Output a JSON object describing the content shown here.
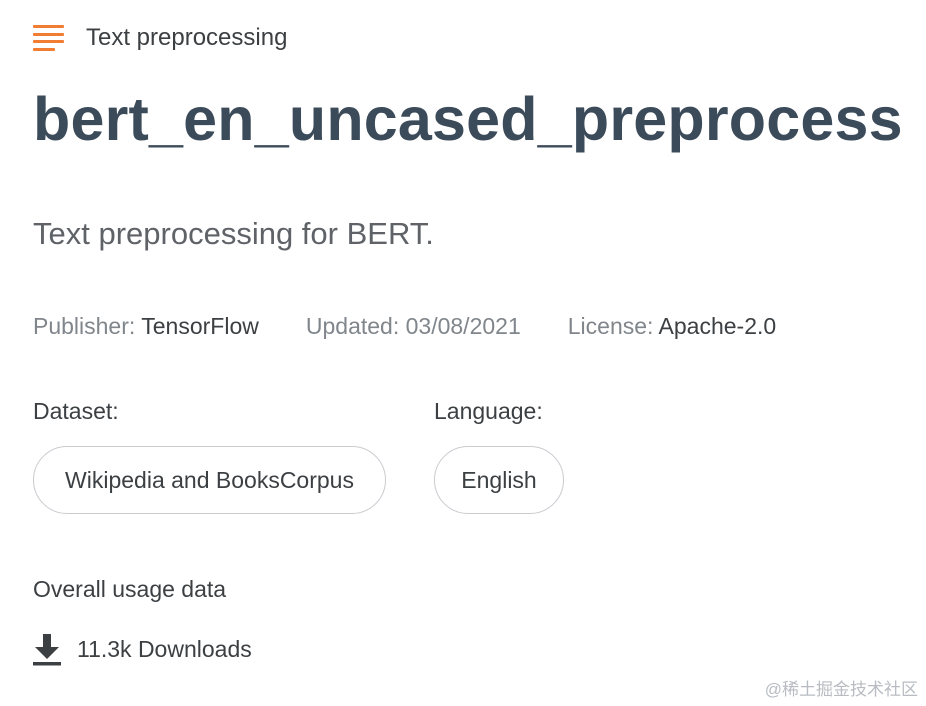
{
  "category": {
    "icon": "list-icon",
    "label": "Text preprocessing",
    "icon_color": "#f07d33"
  },
  "model": {
    "title": "bert_en_uncased_preprocess",
    "description": "Text preprocessing for BERT."
  },
  "meta": {
    "publisher_key": "Publisher:",
    "publisher_value": "TensorFlow",
    "updated_key": "Updated:",
    "updated_value": "03/08/2021",
    "license_key": "License:",
    "license_value": "Apache-2.0"
  },
  "dataset": {
    "label": "Dataset:",
    "value": "Wikipedia and BooksCorpus"
  },
  "language": {
    "label": "Language:",
    "value": "English"
  },
  "usage": {
    "title": "Overall usage data",
    "download_icon": "download-icon",
    "downloads": "11.3k Downloads"
  },
  "watermark": "@稀土掘金技术社区"
}
